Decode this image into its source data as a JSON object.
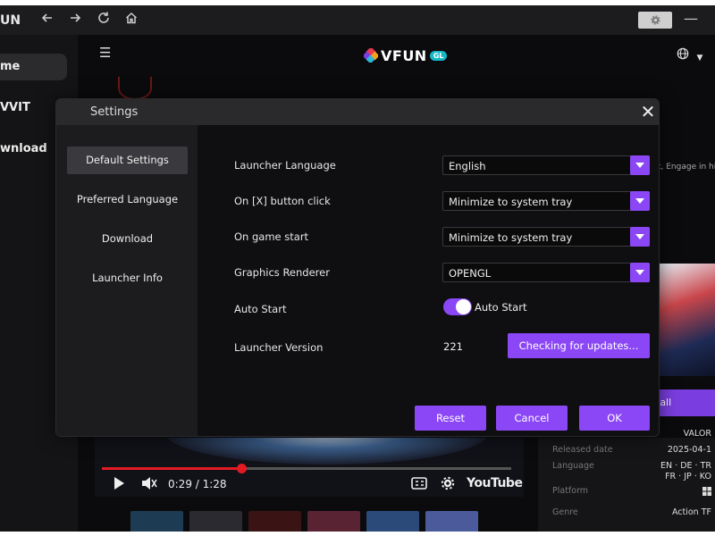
{
  "titlebar": {
    "brand": "UN",
    "back_icon": "arrow-left-icon",
    "forward_icon": "arrow-right-icon",
    "refresh_icon": "refresh-icon",
    "home_icon": "home-icon",
    "gear_icon": "gear-icon",
    "minimize_icon": "minimize-icon"
  },
  "sidebar": {
    "items": [
      {
        "label": "me",
        "active": true
      },
      {
        "label": "VVIT",
        "active": false
      },
      {
        "label": "wnload",
        "active": false
      }
    ]
  },
  "header": {
    "logo_text": "VFUN",
    "logo_badge": "GL"
  },
  "background": {
    "description_snippet": "t, Engage in hig",
    "install_label": "tall",
    "video": {
      "time": "0:29 / 1:28",
      "progress": 0.34,
      "brand": "YouTube"
    },
    "details": {
      "title": "VALOR",
      "rows": [
        {
          "key": "Released date",
          "value": "2025-04-1"
        },
        {
          "key": "Language",
          "value": "EN · DE · TR"
        },
        {
          "key": "",
          "value": "FR · JP · KO"
        },
        {
          "key": "Platform",
          "value": ""
        },
        {
          "key": "Genre",
          "value": "Action TF"
        }
      ]
    }
  },
  "settings": {
    "title": "Settings",
    "nav": [
      {
        "label": "Default Settings",
        "active": true
      },
      {
        "label": "Preferred Language",
        "active": false
      },
      {
        "label": "Download",
        "active": false
      },
      {
        "label": "Launcher Info",
        "active": false
      }
    ],
    "launcher_language": {
      "label": "Launcher Language",
      "value": "English"
    },
    "x_button": {
      "label": "On [X] button click",
      "value": "Minimize to system tray"
    },
    "game_start": {
      "label": "On game start",
      "value": "Minimize to system tray"
    },
    "renderer": {
      "label": "Graphics Renderer",
      "value": "OPENGL"
    },
    "auto_start": {
      "label": "Auto Start",
      "toggle_label": "Auto Start",
      "enabled": true
    },
    "version": {
      "label": "Launcher Version",
      "value": "221",
      "update_button": "Checking for updates..."
    },
    "buttons": {
      "reset": "Reset",
      "cancel": "Cancel",
      "ok": "OK"
    },
    "accent_color": "#8b47f6"
  }
}
